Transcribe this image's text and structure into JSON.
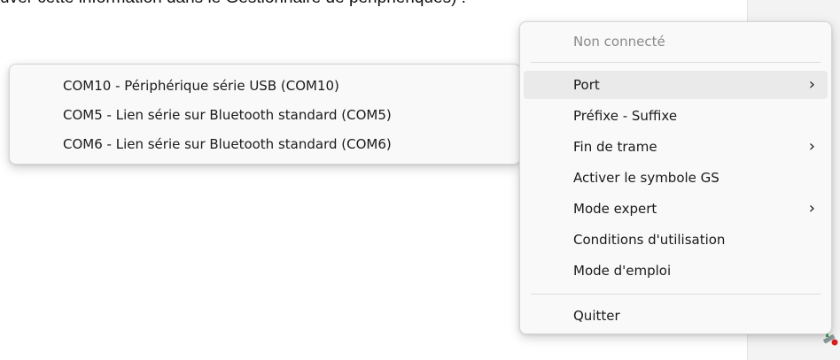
{
  "background": {
    "text": "uver cette information dans le Gestionnaire de périphériques) :"
  },
  "menu": {
    "status": "Non connecté",
    "items": [
      {
        "label": "Port",
        "has_submenu": true
      },
      {
        "label": "Préfixe - Suffixe",
        "has_submenu": false
      },
      {
        "label": "Fin de trame",
        "has_submenu": true
      },
      {
        "label": "Activer le symbole GS",
        "has_submenu": false
      },
      {
        "label": "Mode expert",
        "has_submenu": true
      },
      {
        "label": "Conditions d'utilisation",
        "has_submenu": false
      },
      {
        "label": "Mode d'emploi",
        "has_submenu": false
      }
    ],
    "quit_label": "Quitter",
    "chevron": "›"
  },
  "submenu": {
    "items": [
      {
        "label": "COM10 - Périphérique série USB (COM10)"
      },
      {
        "label": "COM5 - Lien série sur Bluetooth standard (COM5)"
      },
      {
        "label": "COM6 - Lien série sur Bluetooth standard (COM6)"
      }
    ]
  },
  "colors": {
    "menu_bg": "#f9f9f9",
    "hover_bg": "#eaeaea",
    "disabled_text": "#8a8a8a"
  },
  "icons": {
    "tray": "tray-app-icon"
  }
}
